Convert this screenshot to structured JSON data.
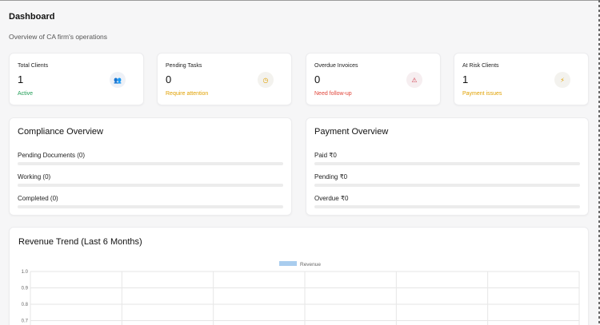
{
  "header": {
    "title": "Dashboard",
    "subtitle": "Overview of CA firm's operations"
  },
  "stats": [
    {
      "label": "Total Clients",
      "value": "1",
      "note": "Active",
      "note_color": "#1f9d55",
      "icon": "users-icon",
      "icon_glyph": "👥",
      "badge_bg": "#eef1f7",
      "icon_color": "#4a5a7a"
    },
    {
      "label": "Pending Tasks",
      "value": "0",
      "note": "Require attention",
      "note_color": "#e0a000",
      "icon": "clock-icon",
      "icon_glyph": "◷",
      "badge_bg": "#f3f2ee",
      "icon_color": "#e0a000"
    },
    {
      "label": "Overdue Invoices",
      "value": "0",
      "note": "Need follow-up",
      "note_color": "#e0453a",
      "icon": "alert-icon",
      "icon_glyph": "⚠",
      "badge_bg": "#f6eef0",
      "icon_color": "#d23a4a"
    },
    {
      "label": "At Risk Clients",
      "value": "1",
      "note": "Payment issues",
      "note_color": "#e0a000",
      "icon": "lightning-icon",
      "icon_glyph": "⚡",
      "badge_bg": "#f3f2ee",
      "icon_color": "#e0a000"
    }
  ],
  "compliance": {
    "title": "Compliance Overview",
    "rows": [
      {
        "label": "Pending Documents (0)",
        "progress": 0
      },
      {
        "label": "Working (0)",
        "progress": 0
      },
      {
        "label": "Completed (0)",
        "progress": 0
      }
    ]
  },
  "payment": {
    "title": "Payment Overview",
    "rows": [
      {
        "label": "Paid ₹0",
        "progress": 0
      },
      {
        "label": "Pending ₹0",
        "progress": 0
      },
      {
        "label": "Overdue ₹0",
        "progress": 0
      }
    ]
  },
  "revenue": {
    "title": "Revenue Trend (Last 6 Months)"
  },
  "chart_data": {
    "type": "line",
    "title": "",
    "series": [
      {
        "name": "Revenue",
        "values": [],
        "color": "#a9cdee"
      }
    ],
    "yticks": [
      "1.0",
      "0.9",
      "0.8",
      "0.7"
    ],
    "ylim": [
      0.7,
      1.0
    ],
    "grid": true,
    "legend": "top-center"
  }
}
